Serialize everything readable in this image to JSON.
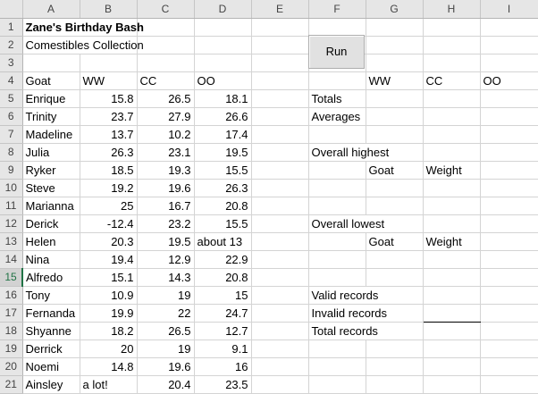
{
  "columns": [
    "A",
    "B",
    "C",
    "D",
    "E",
    "F",
    "G",
    "H",
    "I"
  ],
  "rows": [
    {
      "n": "1",
      "A": "Zane's Birthday Bash"
    },
    {
      "n": "2",
      "A": "Comestibles Collection"
    },
    {
      "n": "3"
    },
    {
      "n": "4",
      "A": "Goat",
      "B": "WW",
      "C": "CC",
      "D": "OO",
      "G": "WW",
      "H": "CC",
      "I": "OO"
    },
    {
      "n": "5",
      "A": "Enrique",
      "B": "15.8",
      "C": "26.5",
      "D": "18.1",
      "F": "Totals"
    },
    {
      "n": "6",
      "A": "Trinity",
      "B": "23.7",
      "C": "27.9",
      "D": "26.6",
      "F": "Averages"
    },
    {
      "n": "7",
      "A": "Madeline",
      "B": "13.7",
      "C": "10.2",
      "D": "17.4"
    },
    {
      "n": "8",
      "A": "Julia",
      "B": "26.3",
      "C": "23.1",
      "D": "19.5",
      "F": "Overall highest"
    },
    {
      "n": "9",
      "A": "Ryker",
      "B": "18.5",
      "C": "19.3",
      "D": "15.5",
      "G": "Goat",
      "H": "Weight"
    },
    {
      "n": "10",
      "A": "Steve",
      "B": "19.2",
      "C": "19.6",
      "D": "26.3"
    },
    {
      "n": "11",
      "A": "Marianna",
      "B": "25",
      "C": "16.7",
      "D": "20.8"
    },
    {
      "n": "12",
      "A": "Derick",
      "B": "-12.4",
      "C": "23.2",
      "D": "15.5",
      "F": "Overall lowest"
    },
    {
      "n": "13",
      "A": "Helen",
      "B": "20.3",
      "C": "19.5",
      "D": "about 13",
      "G": "Goat",
      "H": "Weight"
    },
    {
      "n": "14",
      "A": "Nina",
      "B": "19.4",
      "C": "12.9",
      "D": "22.9"
    },
    {
      "n": "15",
      "A": "Alfredo",
      "B": "15.1",
      "C": "14.3",
      "D": "20.8"
    },
    {
      "n": "16",
      "A": "Tony",
      "B": "10.9",
      "C": "19",
      "D": "15",
      "F": "Valid records"
    },
    {
      "n": "17",
      "A": "Fernanda",
      "B": "19.9",
      "C": "22",
      "D": "24.7",
      "F": "Invalid records"
    },
    {
      "n": "18",
      "A": "Shyanne",
      "B": "18.2",
      "C": "26.5",
      "D": "12.7",
      "F": "Total records"
    },
    {
      "n": "19",
      "A": "Derrick",
      "B": "20",
      "C": "19",
      "D": "9.1"
    },
    {
      "n": "20",
      "A": "Noemi",
      "B": "14.8",
      "C": "19.6",
      "D": "16"
    },
    {
      "n": "21",
      "A": "Ainsley",
      "B": "a lot!",
      "C": "20.4",
      "D": "23.5"
    }
  ],
  "run_button": {
    "label": "Run"
  },
  "selected_row": "15",
  "accent_color": "#217346"
}
